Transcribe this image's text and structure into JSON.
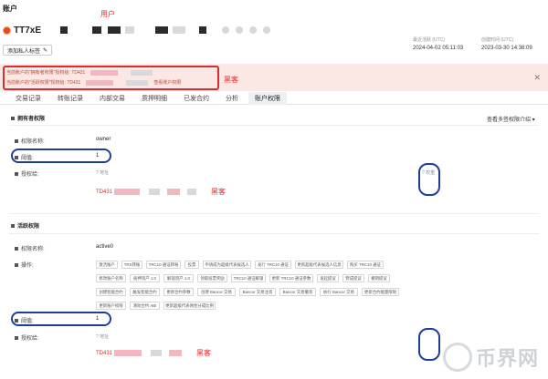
{
  "header": {
    "title": "账户",
    "annotation_user": "用户",
    "address_prefix": "TT7xE",
    "last_active_label": "最近活跃 (UTC)",
    "last_active_value": "2024-04-02 05:11:03",
    "created_label": "创建时间 (UTC)",
    "created_value": "2023-03-30 14:38:09",
    "add_label_button": "添加私人标签"
  },
  "banner": {
    "line1": "当前账户的\"拥有者权限\"授权给:  TD431",
    "line2": "当前账户的\"活跃权限\"授权给:  TD431",
    "line2_suffix": "查看账户权限",
    "annotation": "黑客"
  },
  "tabs": [
    "交易记录",
    "转账记录",
    "内部交易",
    "质押明细",
    "已发合约",
    "分析",
    "账户权限"
  ],
  "active_tab_index": 6,
  "owner": {
    "section_title": "拥有者权限",
    "multisig_link": "查看多签权限介绍",
    "name_label": "权限名称:",
    "name_value": "owner",
    "threshold_label": "阈值:",
    "threshold_value": "1",
    "grant_label": "授权给:",
    "address_col": "地址",
    "weight_col": "权重",
    "grant_address": "TD431",
    "annotation": "黑客"
  },
  "active": {
    "section_title": "活跃权限",
    "name_label": "权限名称:",
    "name_value": "active0",
    "ops_label": "操作:",
    "operations": [
      [
        "激活账户",
        "TRX转账",
        "TRC10 通证转账",
        "投票",
        "申请成为超级代表候选人",
        "发行 TRC10 通证",
        "更新超级代表候选人信息",
        "购买 TRC10 通证"
      ],
      [
        "修改账户名称",
        "质押资产 1.0",
        "解锁资产 1.0",
        "领取投票奖励",
        "TRC10 通证解锁",
        "更新 TRC10 通证参数",
        "发起提议",
        "赞成提议",
        "撤销提议"
      ],
      [
        "创建智能合约",
        "触发智能合约",
        "更新合约参数",
        "创建 Bancor 交易",
        "Bancor 交易注资",
        "Bancor 交易撤资",
        "执行 Bancor 交易",
        "更新合约能量限制"
      ],
      [
        "更新账户权限",
        "清除合约 ABI",
        "更新超级代表佣金分成比例"
      ]
    ],
    "threshold_label": "阈值:",
    "threshold_value": "1",
    "grant_label": "授权给:",
    "address_col": "地址",
    "grant_address": "TD431",
    "annotation": "黑客"
  },
  "watermark": "币界网"
}
